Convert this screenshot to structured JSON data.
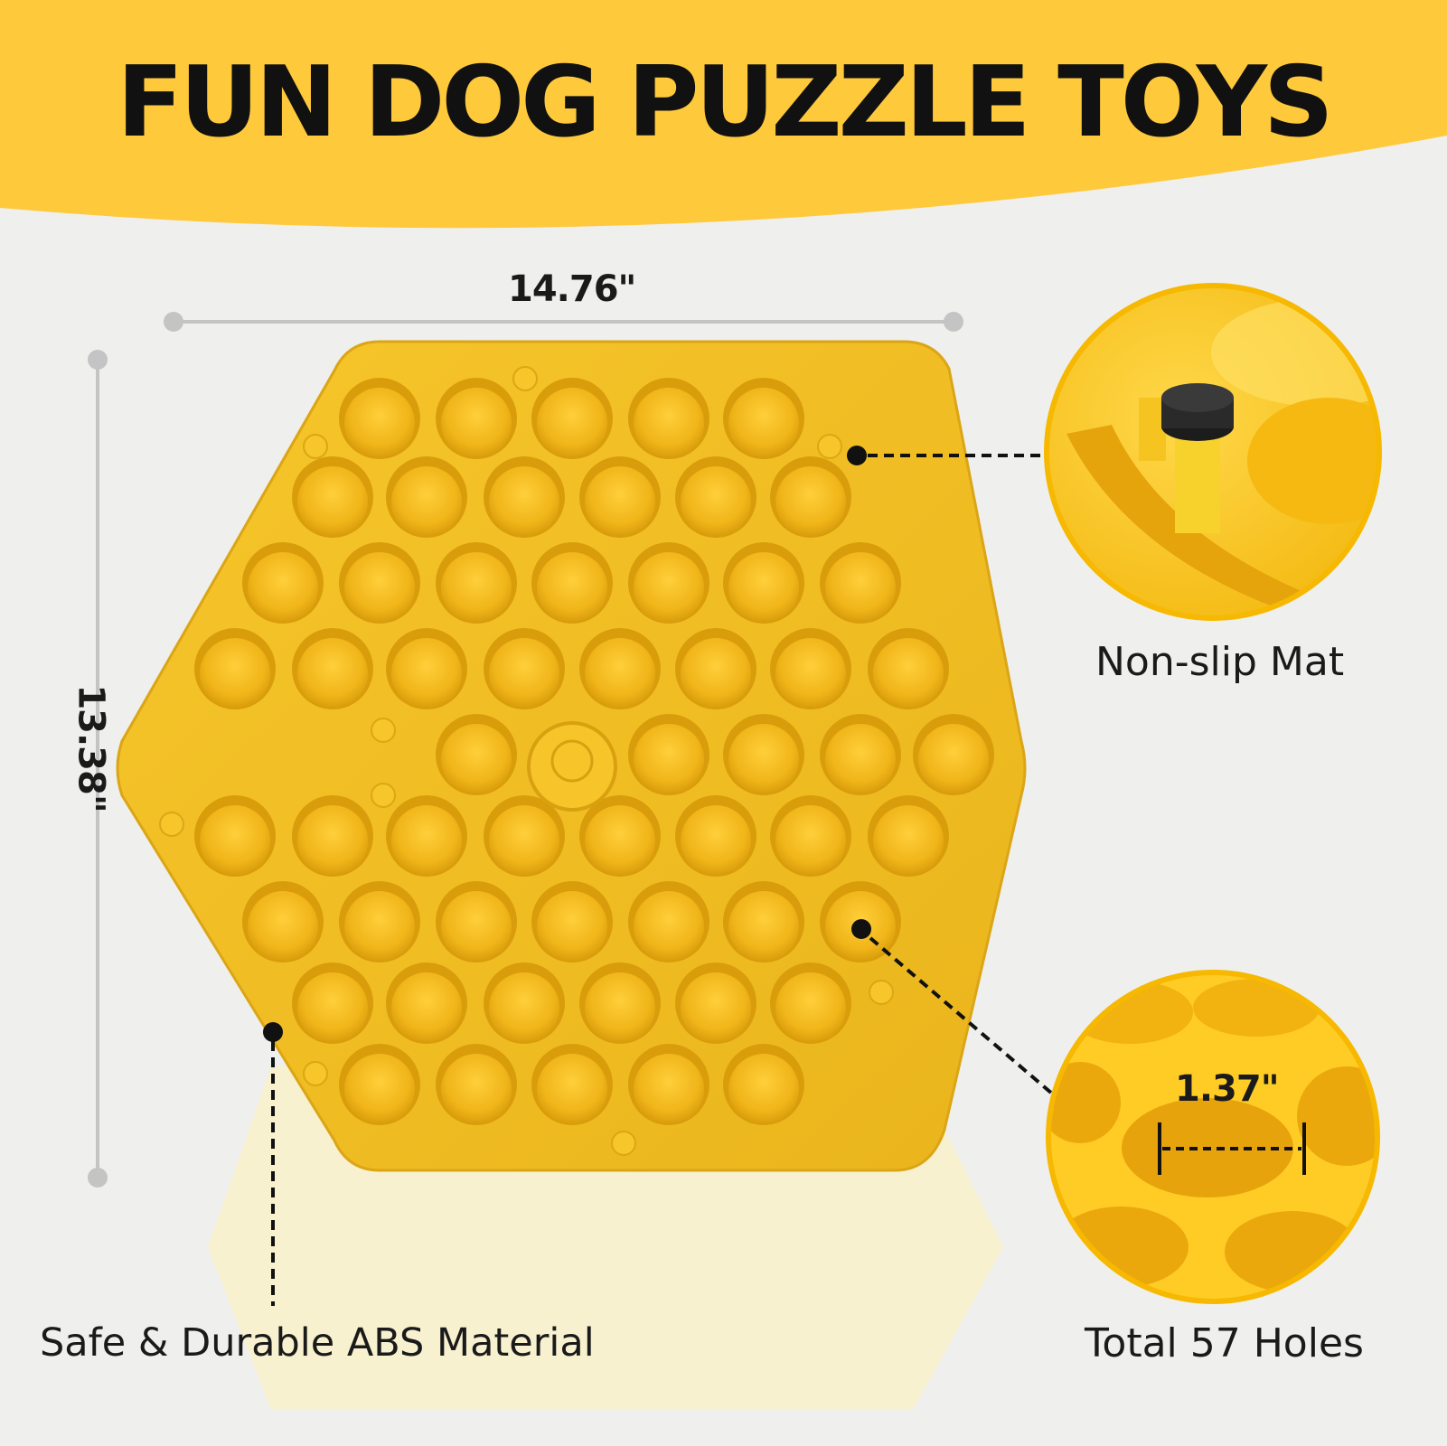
{
  "banner": {
    "title": "FUN DOG PUZZLE TOYS",
    "color": "#ffc93c"
  },
  "dimensions": {
    "width": "14.76\"",
    "height": "13.38\"",
    "hole_diameter": "1.37\""
  },
  "callouts": {
    "non_slip": "Non-slip Mat",
    "holes": "Total 57 Holes",
    "material": "Safe & Durable ABS Material"
  },
  "colors": {
    "board": "#f2bf22",
    "hole": "#e3aa12",
    "hole_inner": "#ffc82c",
    "accent": "#ffc93c",
    "background": "#efefed"
  }
}
